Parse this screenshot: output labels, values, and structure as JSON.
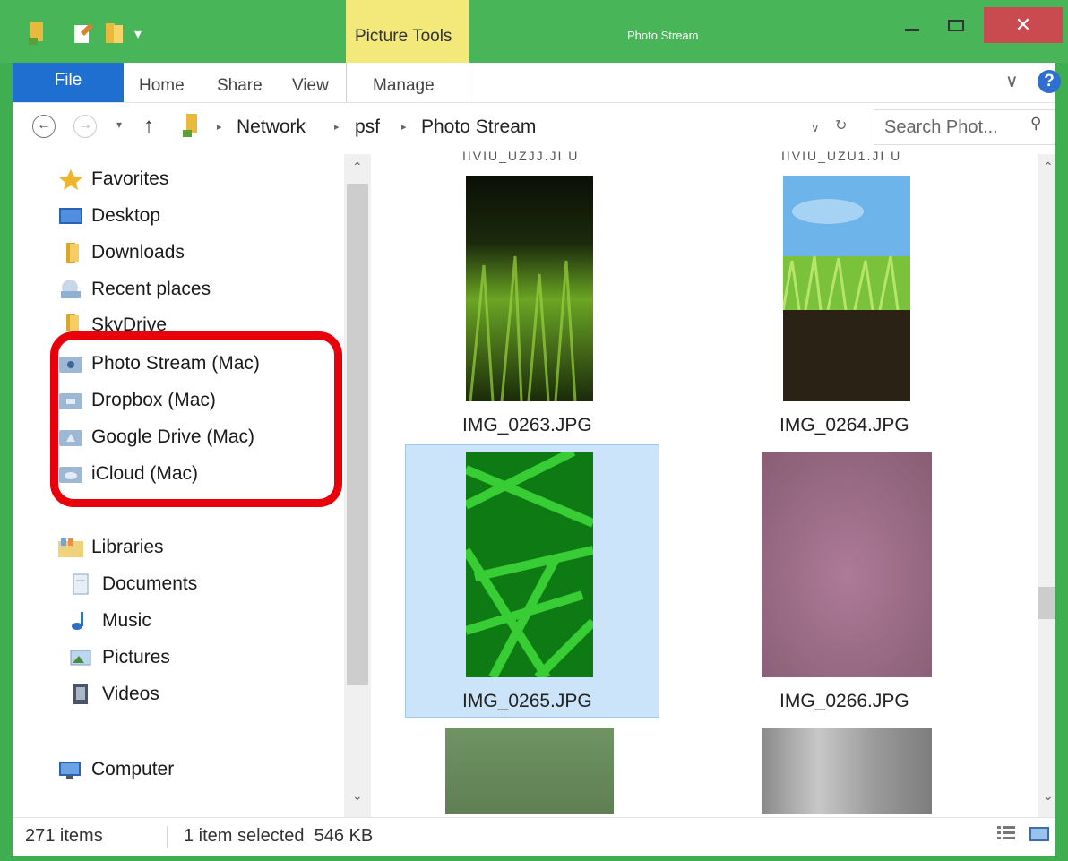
{
  "window": {
    "title": "Photo Stream",
    "context_tab": "Picture Tools",
    "close_glyph": "✕",
    "accent_color": "#47b558",
    "context_color": "#f2e97a",
    "close_color": "#c94a4f"
  },
  "ribbon": {
    "file": "File",
    "tabs": [
      "Home",
      "Share",
      "View",
      "Manage"
    ],
    "expand_glyph": "∨",
    "help_glyph": "?"
  },
  "address": {
    "back_glyph": "←",
    "forward_glyph": "→",
    "up_glyph": "↑",
    "breadcrumb": [
      "Network",
      "psf",
      "Photo Stream"
    ],
    "search_placeholder": "Search Phot..."
  },
  "nav": {
    "favorites": [
      {
        "label": "Favorites",
        "icon": "star-icon"
      },
      {
        "label": "Desktop",
        "icon": "desktop-icon"
      },
      {
        "label": "Downloads",
        "icon": "folder-icon"
      },
      {
        "label": "Recent places",
        "icon": "recent-places-icon"
      },
      {
        "label": "SkyDrive",
        "icon": "folder-icon"
      }
    ],
    "mac_shares": [
      {
        "label": "Photo Stream (Mac)",
        "icon": "network-drive-icon"
      },
      {
        "label": "Dropbox (Mac)",
        "icon": "network-drive-icon"
      },
      {
        "label": "Google Drive (Mac)",
        "icon": "network-drive-icon"
      },
      {
        "label": "iCloud (Mac)",
        "icon": "network-drive-icon"
      }
    ],
    "libraries": [
      {
        "label": "Libraries",
        "icon": "libraries-icon"
      },
      {
        "label": "Documents",
        "icon": "documents-icon"
      },
      {
        "label": "Music",
        "icon": "music-icon"
      },
      {
        "label": "Pictures",
        "icon": "pictures-icon"
      },
      {
        "label": "Videos",
        "icon": "videos-icon"
      }
    ],
    "computer": {
      "label": "Computer",
      "icon": "computer-icon"
    }
  },
  "files": [
    {
      "name": "IMG_0263.JPG",
      "selected": false,
      "colors": [
        "#0b0f06",
        "#6aa524",
        "#1a2a0a"
      ]
    },
    {
      "name": "IMG_0264.JPG",
      "selected": false,
      "colors": [
        "#6db4ea",
        "#7ac23a",
        "#2b2216"
      ]
    },
    {
      "name": "IMG_0265.JPG",
      "selected": true,
      "colors": [
        "#0e7a14",
        "#3fdc3a",
        "#0a5a10"
      ]
    },
    {
      "name": "IMG_0266.JPG",
      "selected": false,
      "colors": [
        "#9b6a86",
        "#a0728f",
        "#875b72"
      ]
    }
  ],
  "status": {
    "items": "271 items",
    "selection": "1 item selected  546 KB"
  }
}
